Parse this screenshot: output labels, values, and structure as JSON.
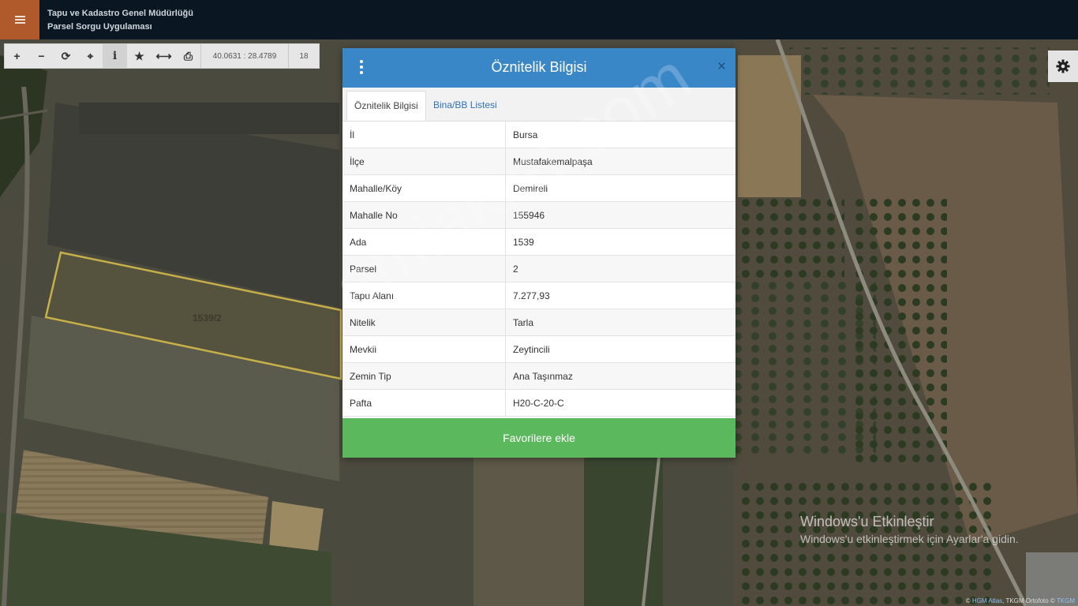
{
  "header": {
    "menu_icon": "hamburger-icon",
    "title_line1": "Tapu ve Kadastro Genel Müdürlüğü",
    "title_line2": "Parsel Sorgu Uygulaması",
    "accent_color": "#b05a2c",
    "bar_color": "#0a1622"
  },
  "toolbar": {
    "buttons": [
      {
        "icon": "plus-icon",
        "glyph": "+"
      },
      {
        "icon": "minus-icon",
        "glyph": "−"
      },
      {
        "icon": "refresh-icon",
        "glyph": "⟳"
      },
      {
        "icon": "crosshair-icon",
        "glyph": "⌖"
      },
      {
        "icon": "info-icon",
        "glyph": "i"
      },
      {
        "icon": "star-icon",
        "glyph": "★"
      },
      {
        "icon": "measure-icon",
        "glyph": "⟷"
      },
      {
        "icon": "print-icon",
        "glyph": "⎙"
      }
    ],
    "coordinates": "40.0631 : 28.4789",
    "zoom": "18"
  },
  "map": {
    "parcel_label": "1539/2"
  },
  "modal": {
    "title": "Öznitelik Bilgisi",
    "close_glyph": "×",
    "header_color": "#3a87c8",
    "tabs": [
      {
        "label": "Öznitelik Bilgisi",
        "active": true
      },
      {
        "label": "Bina/BB Listesi",
        "active": false
      }
    ],
    "rows": [
      {
        "key": "İl",
        "value": "Bursa"
      },
      {
        "key": "İlçe",
        "value": "Mustafakemalpaşa"
      },
      {
        "key": "Mahalle/Köy",
        "value": "Demireli"
      },
      {
        "key": "Mahalle No",
        "value": "155946"
      },
      {
        "key": "Ada",
        "value": "1539"
      },
      {
        "key": "Parsel",
        "value": "2"
      },
      {
        "key": "Tapu Alanı",
        "value": "7.277,93"
      },
      {
        "key": "Nitelik",
        "value": "Tarla"
      },
      {
        "key": "Mevkii",
        "value": "Zeytincili"
      },
      {
        "key": "Zemin Tip",
        "value": "Ana Taşınmaz"
      },
      {
        "key": "Pafta",
        "value": "H20-C-20-C"
      }
    ],
    "favorite_button": "Favorilere ekle",
    "favorite_color": "#5cb85c"
  },
  "watermark": "emlakjet.com",
  "windows_activation": {
    "line1": "Windows'u Etkinleştir",
    "line2": "Windows'u etkinleştirmek için Ayarlar'a gidin."
  },
  "attribution": {
    "prefix": "© ",
    "hgm": "HGM Atlas",
    "middle": ", TKGM Ortofoto © ",
    "tkgm": "TKGM"
  }
}
